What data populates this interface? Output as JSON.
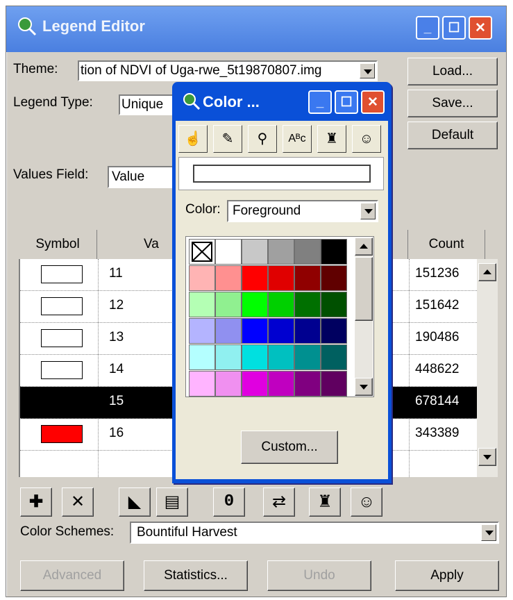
{
  "editor": {
    "title": "Legend Editor",
    "theme_label": "Theme:",
    "theme_value": "tion of NDVI of Uga-rwe_5t19870807.img",
    "legend_type_label": "Legend Type:",
    "legend_type_value": "Unique",
    "load_label": "Load...",
    "save_label": "Save...",
    "default_label": "Default",
    "values_field_label": "Values Field:",
    "values_field_value": "Value",
    "columns": {
      "symbol": "Symbol",
      "value": "Va",
      "count": "Count"
    },
    "rows": [
      {
        "value": "11",
        "count": "151236",
        "color": "#ffffff",
        "selected": false
      },
      {
        "value": "12",
        "count": "151642",
        "color": "#ffffff",
        "selected": false
      },
      {
        "value": "13",
        "count": "190486",
        "color": "#ffffff",
        "selected": false
      },
      {
        "value": "14",
        "count": "448622",
        "color": "#ffffff",
        "selected": false
      },
      {
        "value": "15",
        "count": "678144",
        "color": "#000000",
        "selected": true
      },
      {
        "value": "16",
        "count": "343389",
        "color": "#ff0000",
        "selected": false
      }
    ],
    "color_schemes_label": "Color Schemes:",
    "color_schemes_value": "Bountiful Harvest",
    "advanced_label": "Advanced",
    "statistics_label": "Statistics...",
    "undo_label": "Undo",
    "apply_label": "Apply",
    "zero_label": "0"
  },
  "color_palette": {
    "title": "Color ...",
    "color_label": "Color:",
    "color_value": "Foreground",
    "custom_label": "Custom...",
    "swatches": [
      [
        "none",
        "#ffffff",
        "#c8c8c8",
        "#a0a0a0",
        "#808080",
        "#000000"
      ],
      [
        "#ffb4b4",
        "#ff9090",
        "#ff0000",
        "#e00000",
        "#900000",
        "#600000"
      ],
      [
        "#b4ffb4",
        "#90f090",
        "#00ff00",
        "#00d000",
        "#007000",
        "#005000"
      ],
      [
        "#b4b4ff",
        "#9090f0",
        "#0000ff",
        "#0000d0",
        "#000090",
        "#000060"
      ],
      [
        "#b4ffff",
        "#90f0f0",
        "#00e0e0",
        "#00c0c0",
        "#009090",
        "#006060"
      ],
      [
        "#ffb4ff",
        "#f090f0",
        "#e000e0",
        "#c000c0",
        "#800080",
        "#600060"
      ]
    ]
  }
}
